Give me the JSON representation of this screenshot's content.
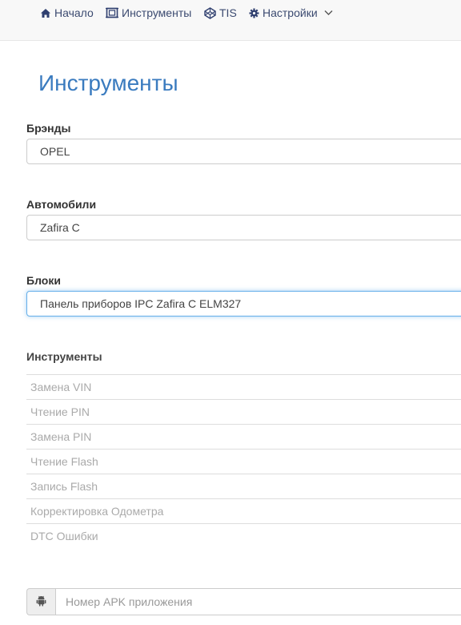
{
  "nav": {
    "home": {
      "label": "Начало",
      "icon": "home-icon"
    },
    "tools": {
      "label": "Инструменты",
      "icon": "tools-frame-icon"
    },
    "tis": {
      "label": "TIS",
      "icon": "codepen-icon"
    },
    "settings": {
      "label": "Настройки",
      "icon": "gear-icon",
      "caret": "chevron-down-icon"
    }
  },
  "page": {
    "title": "Инструменты"
  },
  "form": {
    "brand": {
      "label": "Брэнды",
      "value": "OPEL"
    },
    "car": {
      "label": "Автомобили",
      "value": "Zafira C"
    },
    "unit": {
      "label": "Блоки",
      "value": "Панель приборов IPC Zafira C ELM327"
    }
  },
  "tools": {
    "heading": "Инструменты",
    "items": [
      "Замена VIN",
      "Чтение PIN",
      "Замена PIN",
      "Чтение Flash",
      "Запись Flash",
      "Корректировка Одометра",
      "DTC Ошибки"
    ]
  },
  "apk": {
    "placeholder": "Номер APK приложения",
    "icon": "android-icon"
  },
  "colors": {
    "accent": "#3a7bbf",
    "nav_text": "#3b4a70",
    "focus_border": "#66afe9",
    "disabled_text": "#aaaaaa"
  }
}
